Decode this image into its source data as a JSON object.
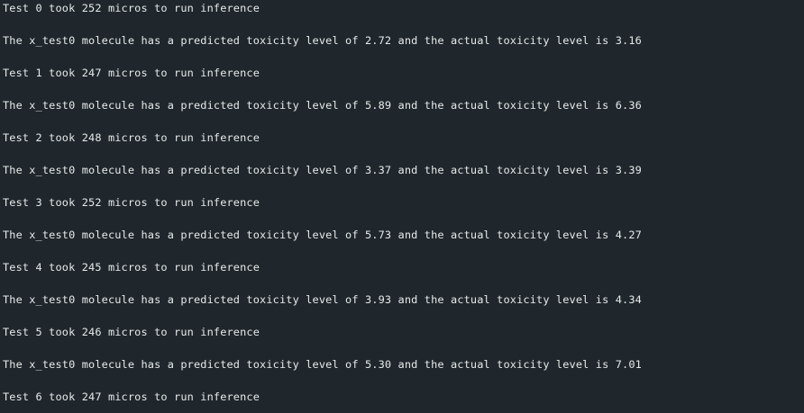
{
  "console": {
    "lines": [
      "Test 0 took 252 micros to run inference",
      "The x_test0 molecule has a predicted toxicity level of 2.72 and the actual toxicity level is 3.16",
      "Test 1 took 247 micros to run inference",
      "The x_test0 molecule has a predicted toxicity level of 5.89 and the actual toxicity level is 6.36",
      "Test 2 took 248 micros to run inference",
      "The x_test0 molecule has a predicted toxicity level of 3.37 and the actual toxicity level is 3.39",
      "Test 3 took 252 micros to run inference",
      "The x_test0 molecule has a predicted toxicity level of 5.73 and the actual toxicity level is 4.27",
      "Test 4 took 245 micros to run inference",
      "The x_test0 molecule has a predicted toxicity level of 3.93 and the actual toxicity level is 4.34",
      "Test 5 took 246 micros to run inference",
      "The x_test0 molecule has a predicted toxicity level of 5.30 and the actual toxicity level is 7.01",
      "Test 6 took 247 micros to run inference"
    ]
  }
}
